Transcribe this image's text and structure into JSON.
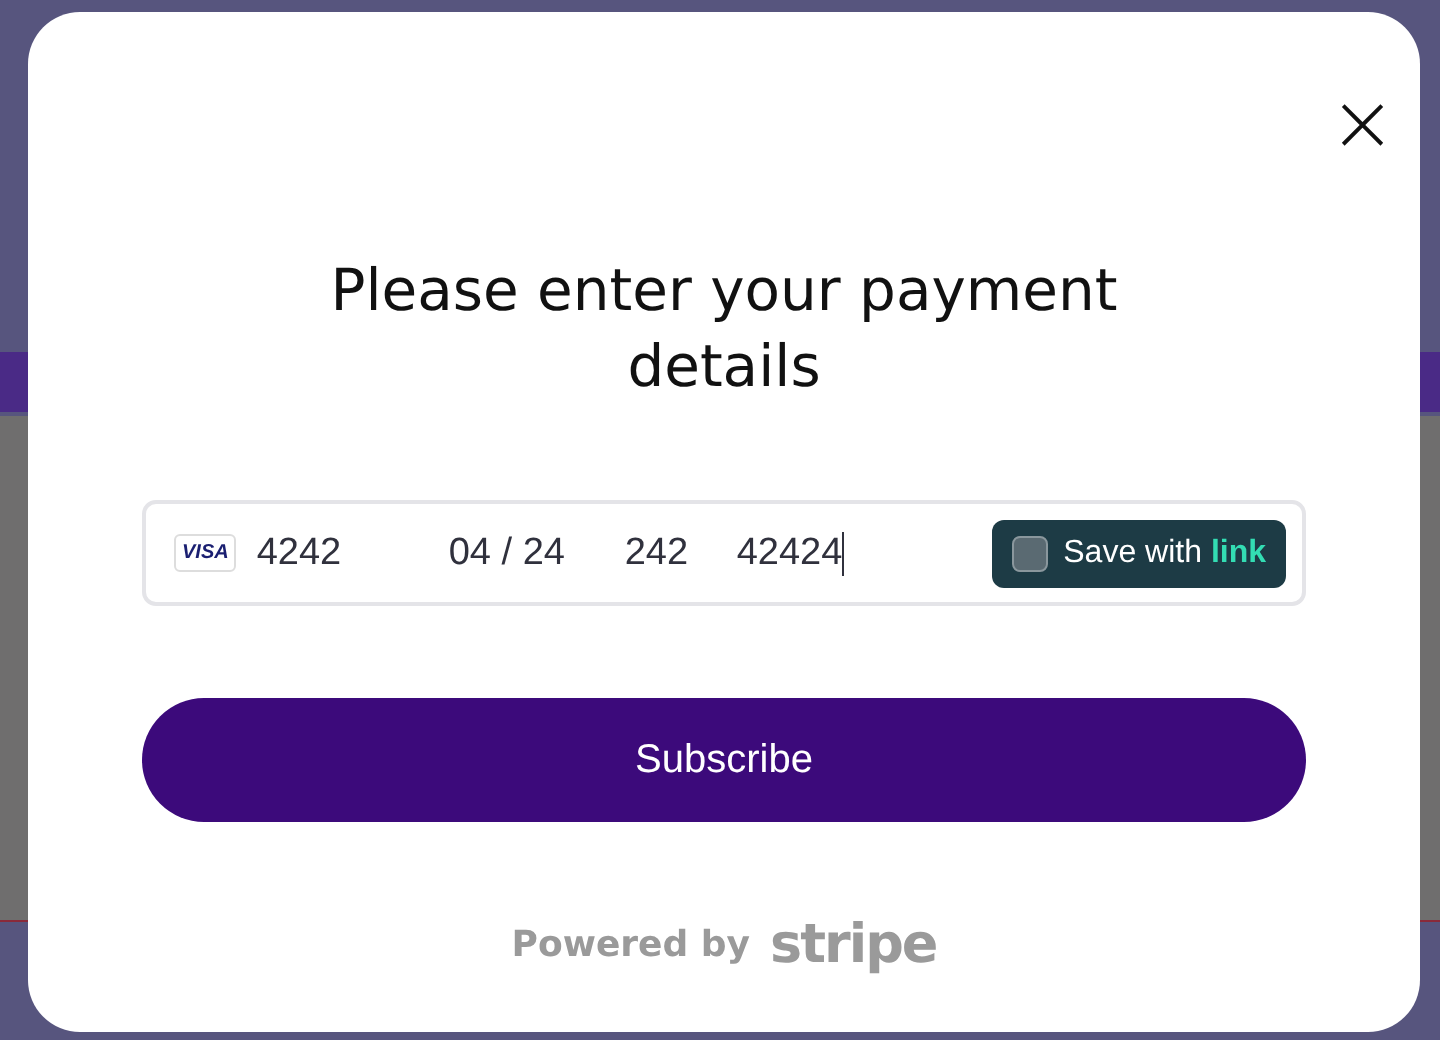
{
  "dialog": {
    "title": "Please enter your payment details",
    "close_label": "×"
  },
  "card_field": {
    "card_brand": "VISA",
    "card_number": "4242",
    "expiry": "04 / 24",
    "cvc": "242",
    "postal_code": "42424",
    "focused": true
  },
  "save_with_link": {
    "label": "Save with",
    "brand": "link",
    "checked": false
  },
  "submit_button": "Subscribe",
  "footer": {
    "prefix": "Powered by",
    "brand": "stripe"
  }
}
